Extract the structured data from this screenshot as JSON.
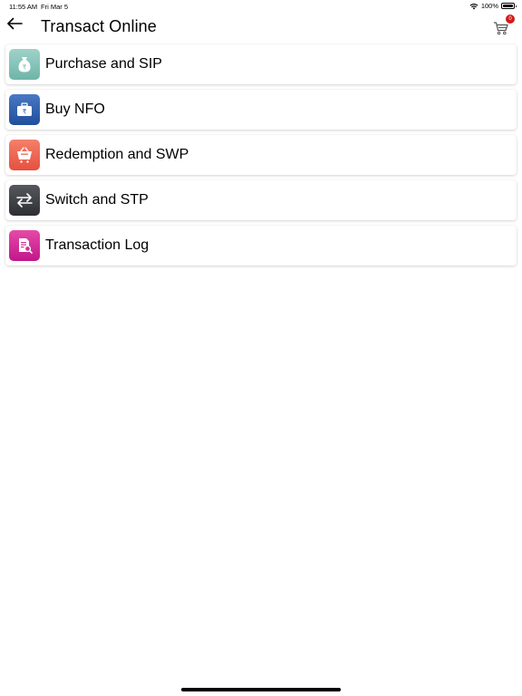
{
  "status_bar": {
    "time": "11:55 AM",
    "date": "Fri Mar 5",
    "battery": "100%",
    "battery_level": 1.0
  },
  "header": {
    "title": "Transact Online",
    "back_icon": "back-arrow-icon",
    "cart_icon": "cart-icon",
    "cart_count": "0"
  },
  "menu": {
    "items": [
      {
        "label": "Purchase and SIP",
        "icon": "money-bag-icon",
        "color_top": "#9fd2c9",
        "color_bottom": "#6fb5a8"
      },
      {
        "label": "Buy NFO",
        "icon": "briefcase-icon",
        "color_top": "#4a78c4",
        "color_bottom": "#1f4e9c"
      },
      {
        "label": "Redemption and SWP",
        "icon": "basket-icon",
        "color_top": "#f4806b",
        "color_bottom": "#e6503f"
      },
      {
        "label": "Switch and STP",
        "icon": "switch-arrows-icon",
        "color_top": "#56585d",
        "color_bottom": "#2d2f33"
      },
      {
        "label": "Transaction Log",
        "icon": "document-search-icon",
        "color_top": "#e64aa8",
        "color_bottom": "#c0178a"
      }
    ]
  }
}
